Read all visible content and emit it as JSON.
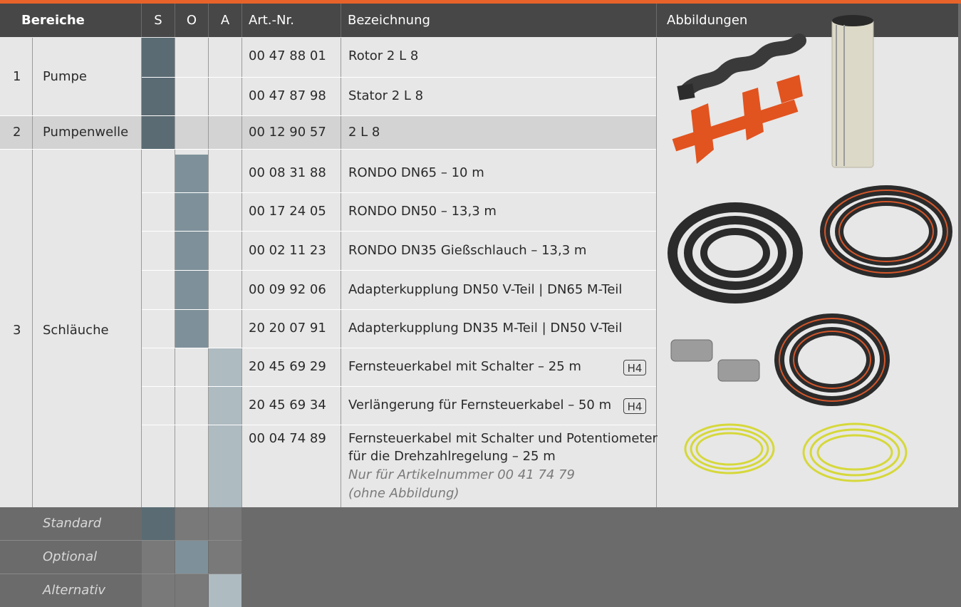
{
  "header": {
    "bereiche": "Bereiche",
    "s": "S",
    "o": "O",
    "a": "A",
    "art_nr": "Art.-Nr.",
    "bezeichnung": "Bezeichnung",
    "abbildungen": "Abbildungen"
  },
  "groups": [
    {
      "num": "1",
      "name": "Pumpe"
    },
    {
      "num": "2",
      "name": "Pumpenwelle"
    },
    {
      "num": "3",
      "name": "Schläuche"
    }
  ],
  "rows": [
    {
      "art": "00 47 88 01",
      "desc": "Rotor 2 L 8",
      "mark": "S"
    },
    {
      "art": "00 47 87 98",
      "desc": "Stator 2 L 8",
      "mark": "S"
    },
    {
      "art": "00 12 90 57",
      "desc": "2 L 8",
      "mark": "S"
    },
    {
      "art": "00 08 31 88",
      "desc": "RONDO DN65 – 10 m",
      "mark": "O"
    },
    {
      "art": "00 17 24 05",
      "desc": "RONDO DN50 – 13,3 m",
      "mark": "O"
    },
    {
      "art": "00 02 11 23",
      "desc": "RONDO DN35 Gießschlauch – 13,3 m",
      "mark": "O"
    },
    {
      "art": "00 09 92 06",
      "desc": "Adapterkupplung DN50 V-Teil | DN65 M-Teil",
      "mark": "O"
    },
    {
      "art": "20 20 07 91",
      "desc": "Adapterkupplung DN35 M-Teil | DN50 V-Teil",
      "mark": "O"
    },
    {
      "art": "20 45 69 29",
      "desc": "Fernsteuerkabel mit Schalter – 25 m",
      "badge": "H4",
      "mark": "A"
    },
    {
      "art": "20 45 69 34",
      "desc": "Verlängerung für Fernsteuerkabel – 50 m",
      "badge": "H4",
      "mark": "A"
    },
    {
      "art": "00 04 74 89",
      "desc": "Fernsteuerkabel mit Schalter und Potentiometer",
      "desc2": "für die Drehzahlregelung – 25 m",
      "note1": "Nur für Artikelnummer 00 41 74 79",
      "note2": "(ohne Abbildung)",
      "mark": "A"
    }
  ],
  "legend": {
    "standard": "Standard",
    "optional": "Optional",
    "alternativ": "Alternativ"
  },
  "colors": {
    "accent": "#e8632a",
    "standard": "#5a6b73",
    "optional": "#7e919a",
    "alternativ": "#aebbc1",
    "header": "#474747"
  },
  "images": [
    "rotor-stator-image",
    "hoses-image",
    "adapter-couplings-image",
    "remote-cables-image"
  ]
}
